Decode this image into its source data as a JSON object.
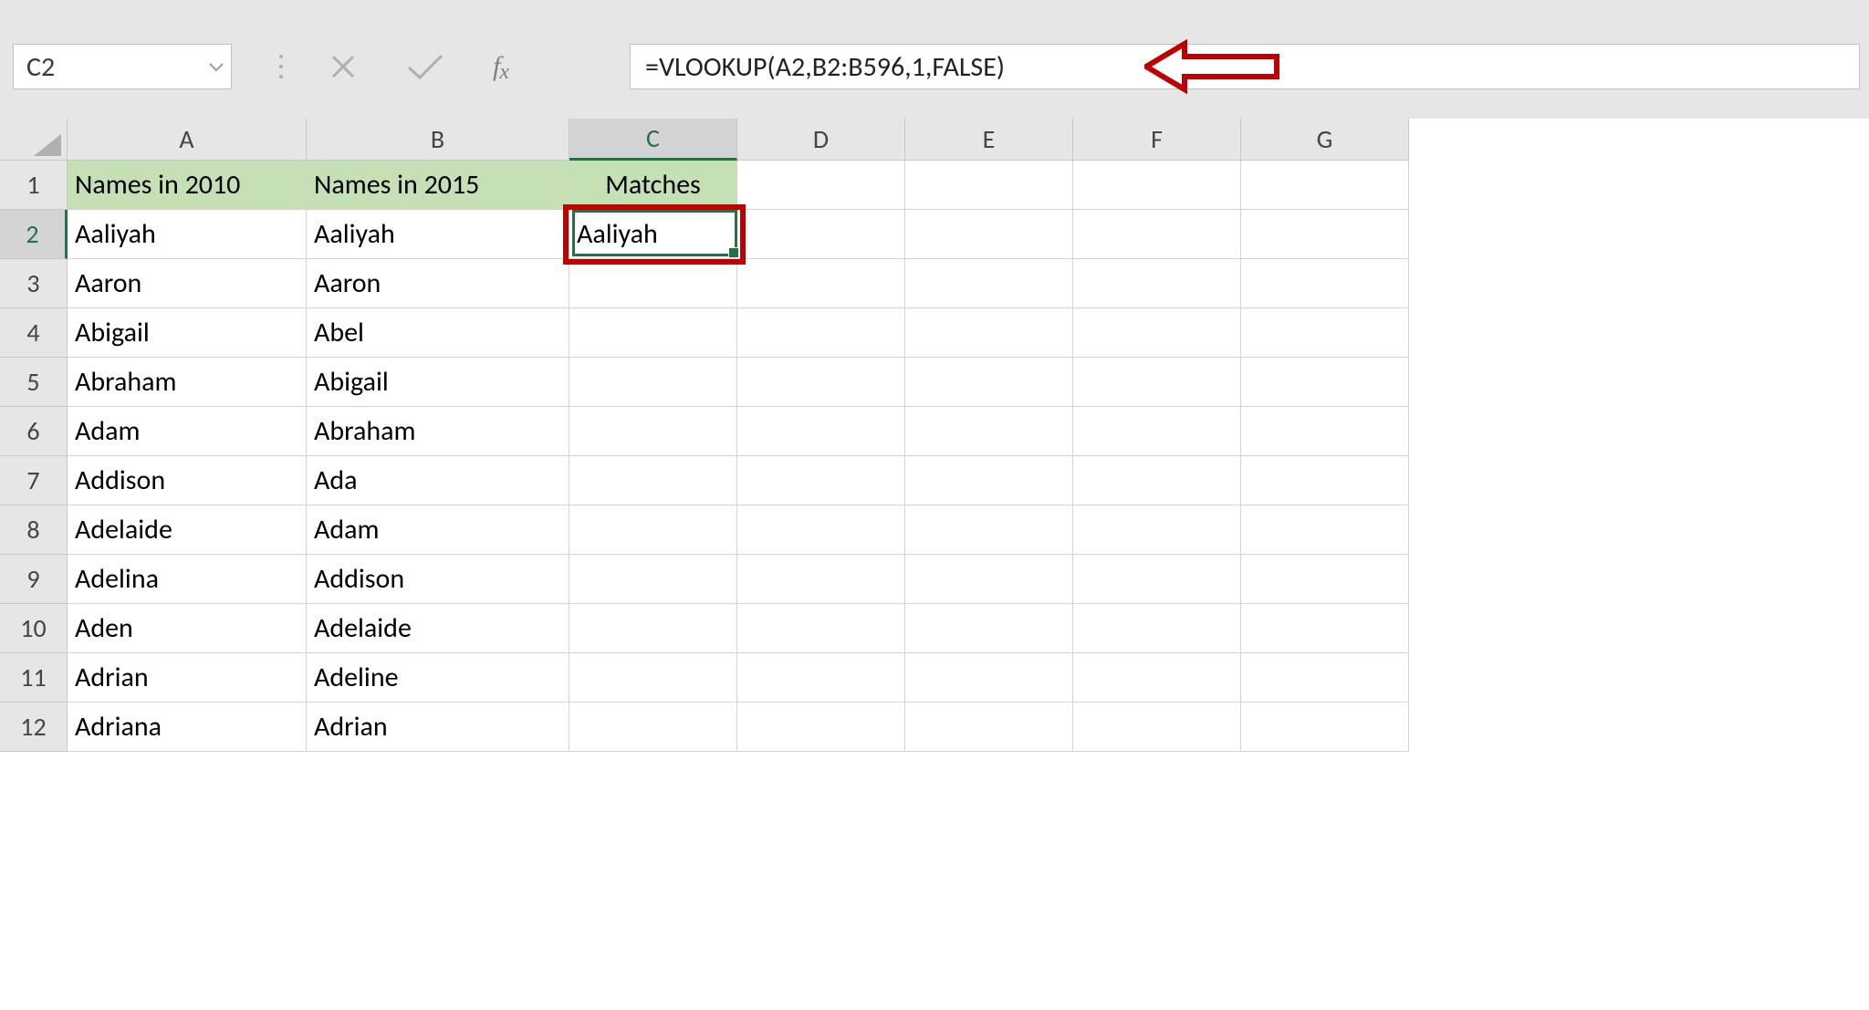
{
  "nameBox": "C2",
  "formula": "=VLOOKUP(A2,B2:B596,1,FALSE)",
  "columns": [
    "A",
    "B",
    "C",
    "D",
    "E",
    "F",
    "G"
  ],
  "selectedCol": "C",
  "selectedRow": 2,
  "rowNumbers": [
    1,
    2,
    3,
    4,
    5,
    6,
    7,
    8,
    9,
    10,
    11,
    12
  ],
  "headerRow": {
    "A": "Names in 2010",
    "B": "Names in 2015",
    "C": "Matches"
  },
  "dataRows": [
    {
      "A": "Aaliyah",
      "B": "Aaliyah",
      "C": "Aaliyah"
    },
    {
      "A": "Aaron",
      "B": "Aaron",
      "C": ""
    },
    {
      "A": "Abigail",
      "B": "Abel",
      "C": ""
    },
    {
      "A": "Abraham",
      "B": "Abigail",
      "C": ""
    },
    {
      "A": "Adam",
      "B": "Abraham",
      "C": ""
    },
    {
      "A": "Addison",
      "B": "Ada",
      "C": ""
    },
    {
      "A": "Adelaide",
      "B": "Adam",
      "C": ""
    },
    {
      "A": "Adelina",
      "B": "Addison",
      "C": ""
    },
    {
      "A": "Aden",
      "B": "Adelaide",
      "C": ""
    },
    {
      "A": "Adrian",
      "B": "Adeline",
      "C": ""
    },
    {
      "A": "Adriana",
      "B": "Adrian",
      "C": ""
    }
  ],
  "colors": {
    "headerFill": "#c5e0b4",
    "selection": "#217346",
    "highlight": "#c00000"
  }
}
